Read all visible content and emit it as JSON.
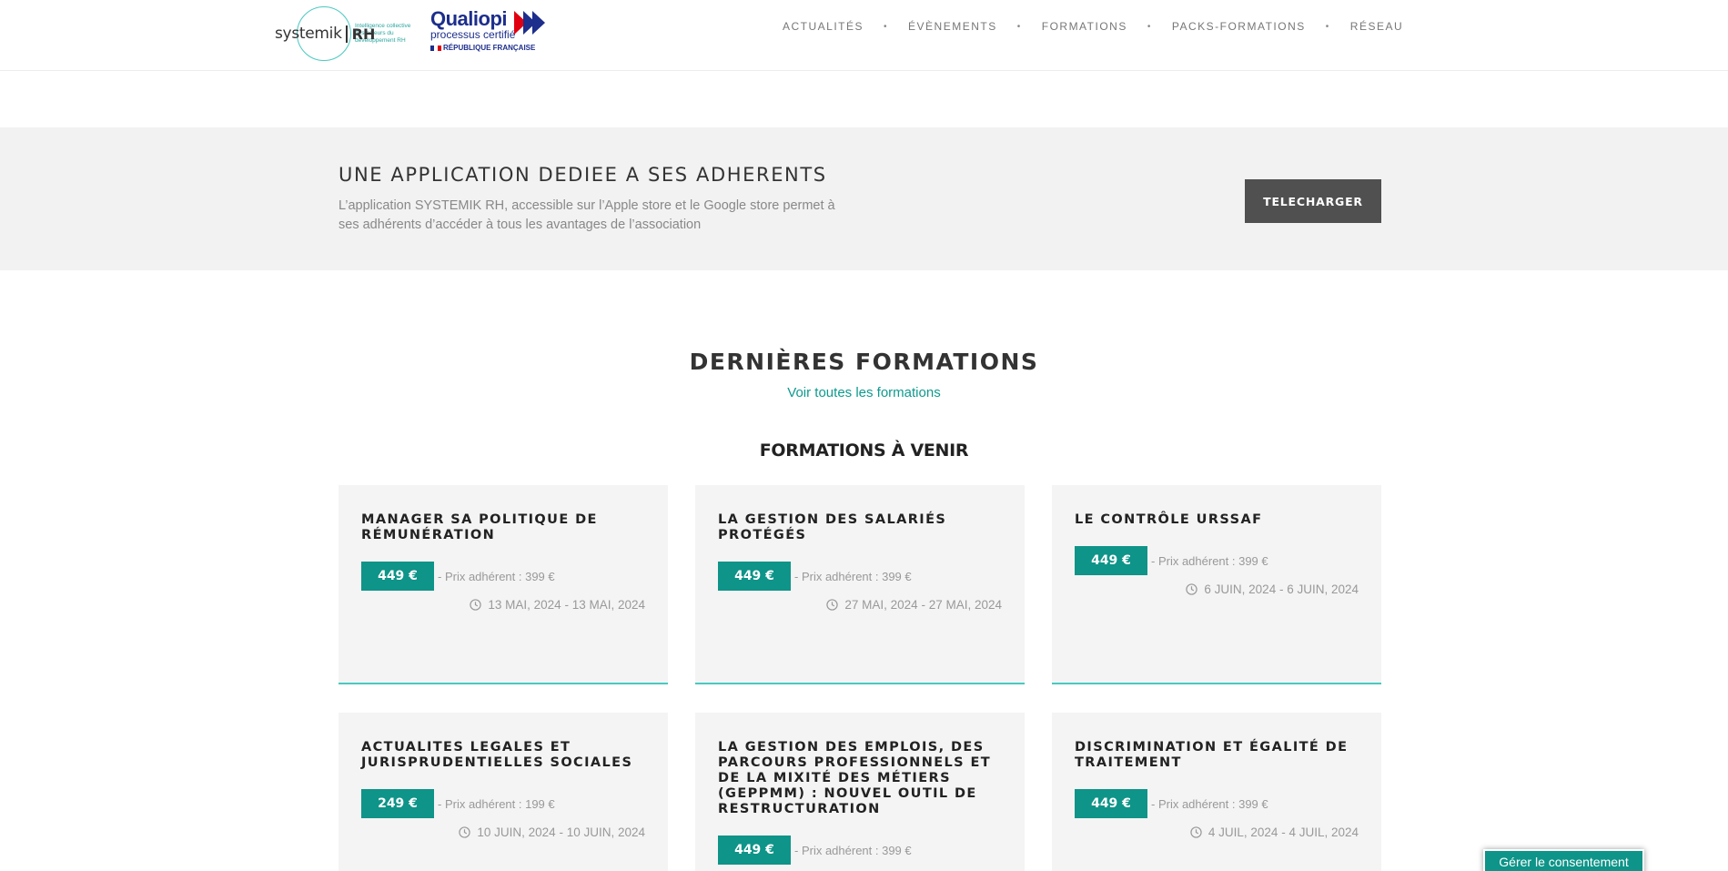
{
  "brand": {
    "name": "systemik",
    "suffix": "RH",
    "tagline": "Intelligence collective des acteurs du développement RH",
    "qualiopi_title": "Qualiopi",
    "qualiopi_sub": "processus certifié",
    "qualiopi_rep": "RÉPUBLIQUE FRANÇAISE"
  },
  "nav": {
    "items": [
      "ACTUALITÉS",
      "ÉVÈNEMENTS",
      "FORMATIONS",
      "PACKS-FORMATIONS",
      "RÉSEAU"
    ],
    "separator": "•"
  },
  "app_band": {
    "title": "UNE APPLICATION DEDIEE A SES ADHERENTS",
    "text": "L’application SYSTEMIK RH, accessible sur l’Apple store et le Google store permet à ses adhérents d’accéder à tous les avantages de l’association",
    "button": "TELECHARGER"
  },
  "formations": {
    "title": "DERNIÈRES FORMATIONS",
    "link": "Voir toutes les formations",
    "subtitle": "FORMATIONS À VENIR",
    "cards": [
      {
        "title": "MANAGER SA POLITIQUE DE RÉMUNÉRATION",
        "price": "449 €",
        "member": "- Prix adhérent : 399 €",
        "dates": "13 MAI, 2024 - 13 MAI, 2024"
      },
      {
        "title": "LA GESTION DES SALARIÉS PROTÉGÉS",
        "price": "449 €",
        "member": "- Prix adhérent : 399 €",
        "dates": "27 MAI, 2024 - 27 MAI, 2024"
      },
      {
        "title": "LE CONTRÔLE URSSAF",
        "price": "449 €",
        "member": "- Prix adhérent : 399 €",
        "dates": "6 JUIN, 2024 - 6 JUIN, 2024"
      },
      {
        "title": "ACTUALITES LEGALES ET JURISPRUDENTIELLES SOCIALES",
        "price": "249 €",
        "member": "- Prix adhérent : 199 €",
        "dates": "10 JUIN, 2024 - 10 JUIN, 2024"
      },
      {
        "title": "LA GESTION DES EMPLOIS, DES PARCOURS PROFESSIONNELS ET DE LA MIXITÉ DES MÉTIERS (GEPPMM) : NOUVEL OUTIL DE RESTRUCTURATION",
        "price": "449 €",
        "member": "- Prix adhérent : 399 €",
        "dates": ""
      },
      {
        "title": "DISCRIMINATION ET ÉGALITÉ DE TRAITEMENT",
        "price": "449 €",
        "member": "- Prix adhérent : 399 €",
        "dates": "4 JUIL, 2024 - 4 JUIL, 2024"
      }
    ]
  },
  "consent": {
    "label": "Gérer le consentement"
  },
  "colors": {
    "accent": "#0e9488",
    "accent_light": "#49c9c1",
    "button_dark": "#505050",
    "band_bg": "#f2f2f2"
  },
  "icons": {
    "date": "clock-icon",
    "qualiopi": "double-arrow-icon"
  }
}
